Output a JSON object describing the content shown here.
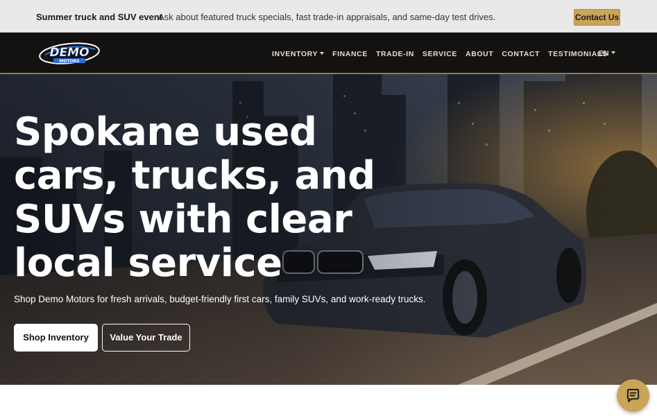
{
  "promo": {
    "title": "Summer truck and SUV event",
    "text": "Ask about featured truck specials, fast trade-in appraisals, and same-day test drives.",
    "cta": "Contact Us"
  },
  "navbar": {
    "logo_text": "DEMO",
    "logo_subtext": "MOTORS",
    "items": [
      {
        "label": "INVENTORY",
        "has_dropdown": true
      },
      {
        "label": "FINANCE"
      },
      {
        "label": "TRADE-IN"
      },
      {
        "label": "SERVICE"
      },
      {
        "label": "ABOUT"
      },
      {
        "label": "CONTACT"
      },
      {
        "label": "TESTIMONIALS"
      }
    ],
    "language": "EN"
  },
  "hero": {
    "headline": "Spokane used cars, trucks, and SUVs with clear local service",
    "subtext": "Shop Demo Motors for fresh arrivals, budget-friendly first cars, family SUVs, and work-ready trucks.",
    "primary_cta": "Shop Inventory",
    "secondary_cta": "Value Your Trade"
  },
  "colors": {
    "accent": "#caa457",
    "navbar_bg": "#141210",
    "promo_bg": "#e9e9ea"
  },
  "chat": {
    "icon": "chat-bubble-icon"
  }
}
